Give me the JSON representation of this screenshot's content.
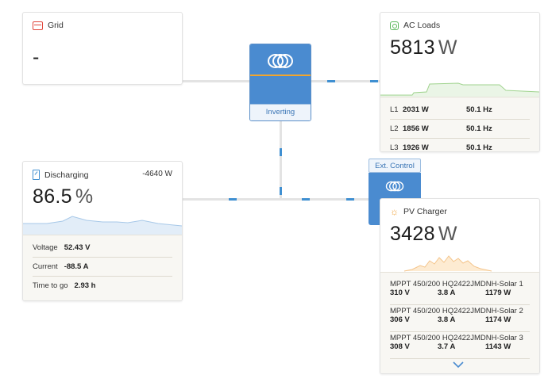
{
  "grid": {
    "title": "Grid",
    "value": "-",
    "icon": "grid-icon"
  },
  "ac_loads": {
    "title": "AC Loads",
    "value": "5813",
    "unit": "W",
    "icon": "ac-loads-icon",
    "phases": [
      {
        "label": "L1",
        "power": "2031 W",
        "freq": "50.1 Hz"
      },
      {
        "label": "L2",
        "power": "1856 W",
        "freq": "50.1 Hz"
      },
      {
        "label": "L3",
        "power": "1926 W",
        "freq": "50.1 Hz"
      }
    ]
  },
  "inverter": {
    "status": "Inverting",
    "logo": "victron-logo-icon"
  },
  "ext_control": {
    "label": "Ext. Control",
    "logo": "victron-logo-icon"
  },
  "battery": {
    "title": "Discharging",
    "power": "-4640 W",
    "value": "86.5",
    "unit": "%",
    "icon": "battery-icon",
    "voltage_label": "Voltage",
    "voltage": "52.43 V",
    "current_label": "Current",
    "current": "-88.5 A",
    "ttg_label": "Time to go",
    "ttg": "2.93 h"
  },
  "pv": {
    "title": "PV Charger",
    "value": "3428",
    "unit": "W",
    "icon": "sun-icon",
    "chargers": [
      {
        "name": "MPPT 450/200 HQ2422JMDNH-Solar 1",
        "voltage": "310 V",
        "current": "3.8 A",
        "power": "1179 W"
      },
      {
        "name": "MPPT 450/200 HQ2422JMDNH-Solar 2",
        "voltage": "306 V",
        "current": "3.8 A",
        "power": "1174 W"
      },
      {
        "name": "MPPT 450/200 HQ2422JMDNH-Solar 3",
        "voltage": "308 V",
        "current": "3.7 A",
        "power": "1143 W"
      }
    ],
    "more_icon": "chevron-down-icon"
  },
  "colors": {
    "accent_blue": "#4a8bd0",
    "stripe_orange": "#f2a52d",
    "grid_red": "#e0443a",
    "ac_green": "#5cb85c",
    "pv_orange": "#f0a23a",
    "battery_blue": "#3f8fd1"
  }
}
